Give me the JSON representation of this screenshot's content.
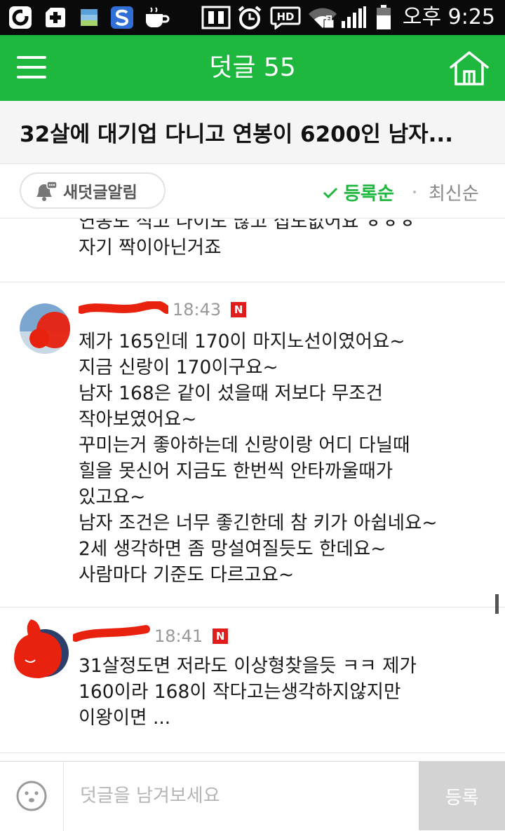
{
  "status_bar": {
    "time": "오후 9:25",
    "icons": [
      "opera-icon",
      "medical-cross-icon",
      "flag-icon",
      "s-app-icon",
      "coffee-cup-icon",
      "nfc-icon",
      "alarm-clock-icon",
      "hd-voice-icon",
      "wifi-lock-icon",
      "signal-bars-icon",
      "battery-icon"
    ],
    "hd_label": "HD"
  },
  "appbar": {
    "title": "덧글 55",
    "background": "#1fb83f"
  },
  "article": {
    "title": "32살에 대기업 다니고 연봉이 6200인 남자..."
  },
  "sortbar": {
    "notify_label": "새덧글알림",
    "sort_registered": "등록순",
    "sort_latest": "최신순",
    "active_color": "#1fb83f"
  },
  "comments": [
    {
      "partial_line": "연봉도 적고 나이도 많고 집도없어요 ㅎㅎㅎ",
      "lines": [
        "자기 짝이아닌거죠"
      ]
    },
    {
      "author": "",
      "time": "18:43",
      "badge": "N",
      "lines": [
        "제가 165인데 170이 마지노선이였어요~",
        "지금 신랑이 170이구요~",
        "남자 168은 같이 섰을때 저보다 무조건",
        "작아보였어요~",
        "꾸미는거 좋아하는데 신랑이랑 어디 다닐때",
        "힐을 못신어 지금도 한번씩 안타까울때가",
        "있고요~",
        "남자 조건은 너무 좋긴한데 참 키가 아쉽네요~",
        "2세 생각하면 좀 망설여질듯도 한데요~",
        "사람마다 기준도 다르고요~"
      ]
    },
    {
      "author": "",
      "time": "18:41",
      "badge": "N",
      "lines": [
        "31살정도면 저라도 이상형찾을듯 ㅋㅋ 제가",
        "160이라 168이 작다고는생각하지않지만",
        "이왕이면 ..."
      ]
    }
  ],
  "input": {
    "placeholder": "덧글을 남겨보세요",
    "submit_label": "등록"
  }
}
